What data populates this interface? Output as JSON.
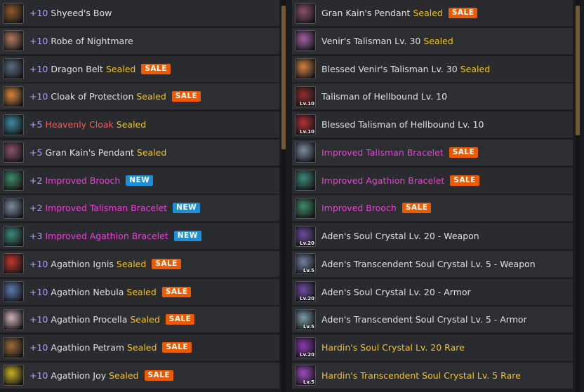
{
  "badges": {
    "sale": "SALE",
    "new": "NEW"
  },
  "left_items": [
    {
      "enchant": "+10",
      "name": "Shyeed's Bow",
      "name_color": "white",
      "sealed": "",
      "badge": "",
      "icon": "bow-icon",
      "icon_color": "#8a5a2b"
    },
    {
      "enchant": "+10",
      "name": "Robe of Nightmare",
      "name_color": "white",
      "sealed": "",
      "badge": "",
      "icon": "robe-icon",
      "icon_color": "#b07a5a"
    },
    {
      "enchant": "+10",
      "name": "Dragon Belt",
      "name_color": "white",
      "sealed": "Sealed",
      "badge": "sale",
      "icon": "belt-icon",
      "icon_color": "#5a6a80"
    },
    {
      "enchant": "+10",
      "name": "Cloak of Protection",
      "name_color": "white",
      "sealed": "Sealed",
      "badge": "sale",
      "icon": "cloak-icon",
      "icon_color": "#d8853a"
    },
    {
      "enchant": "+5",
      "name": "Heavenly Cloak",
      "name_color": "red",
      "sealed": "Sealed",
      "badge": "",
      "icon": "cloak-icon",
      "icon_color": "#3a8aa0"
    },
    {
      "enchant": "+5",
      "name": "Gran Kain's Pendant",
      "name_color": "white",
      "sealed": "Sealed",
      "badge": "",
      "icon": "pendant-icon",
      "icon_color": "#8a5068"
    },
    {
      "enchant": "+2",
      "name": "Improved Brooch",
      "name_color": "pink",
      "sealed": "",
      "badge": "new",
      "icon": "brooch-icon",
      "icon_color": "#3d8a6a"
    },
    {
      "enchant": "+2",
      "name": "Improved Talisman Bracelet",
      "name_color": "pink",
      "sealed": "",
      "badge": "new",
      "icon": "bracelet-icon",
      "icon_color": "#7a8aa0"
    },
    {
      "enchant": "+3",
      "name": "Improved Agathion Bracelet",
      "name_color": "pink",
      "sealed": "",
      "badge": "new",
      "icon": "bracelet-icon",
      "icon_color": "#3a8a7a"
    },
    {
      "enchant": "+10",
      "name": "Agathion Ignis",
      "name_color": "white",
      "sealed": "Sealed",
      "badge": "sale",
      "icon": "agathion-icon",
      "icon_color": "#c0352a"
    },
    {
      "enchant": "+10",
      "name": "Agathion Nebula",
      "name_color": "white",
      "sealed": "Sealed",
      "badge": "sale",
      "icon": "agathion-icon",
      "icon_color": "#5a7ab0"
    },
    {
      "enchant": "+10",
      "name": "Agathion Procella",
      "name_color": "white",
      "sealed": "Sealed",
      "badge": "sale",
      "icon": "agathion-icon",
      "icon_color": "#d0b0b8"
    },
    {
      "enchant": "+10",
      "name": "Agathion Petram",
      "name_color": "white",
      "sealed": "Sealed",
      "badge": "sale",
      "icon": "agathion-icon",
      "icon_color": "#9a6a3a"
    },
    {
      "enchant": "+10",
      "name": "Agathion Joy",
      "name_color": "white",
      "sealed": "Sealed",
      "badge": "sale",
      "icon": "agathion-icon",
      "icon_color": "#c8b020"
    }
  ],
  "right_items": [
    {
      "name": "Gran Kain's Pendant",
      "name_color": "white",
      "sealed": "Sealed",
      "badge": "sale",
      "icon": "pendant-icon",
      "icon_color": "#8a5068",
      "lv": ""
    },
    {
      "name": "Venir's Talisman Lv. 30",
      "name_color": "white",
      "sealed": "Sealed",
      "badge": "",
      "icon": "talisman-icon",
      "icon_color": "#a060a0",
      "lv": ""
    },
    {
      "name": "Blessed Venir's Talisman Lv. 30",
      "name_color": "white",
      "sealed": "Sealed",
      "badge": "",
      "icon": "talisman-icon",
      "icon_color": "#d08040",
      "lv": ""
    },
    {
      "name": "Talisman of Hellbound Lv. 10",
      "name_color": "white",
      "sealed": "",
      "badge": "",
      "icon": "talisman-icon",
      "icon_color": "#902a2a",
      "lv": "Lv.10"
    },
    {
      "name": "Blessed Talisman of Hellbound Lv. 10",
      "name_color": "white",
      "sealed": "",
      "badge": "",
      "icon": "talisman-icon",
      "icon_color": "#b03030",
      "lv": "Lv.10"
    },
    {
      "name": "Improved Talisman Bracelet",
      "name_color": "pink",
      "sealed": "",
      "badge": "sale",
      "icon": "bracelet-icon",
      "icon_color": "#7a8aa0",
      "lv": ""
    },
    {
      "name": "Improved Agathion Bracelet",
      "name_color": "pink",
      "sealed": "",
      "badge": "sale",
      "icon": "bracelet-icon",
      "icon_color": "#3a8a7a",
      "lv": ""
    },
    {
      "name": "Improved Brooch",
      "name_color": "pink",
      "sealed": "",
      "badge": "sale",
      "icon": "brooch-icon",
      "icon_color": "#3d8a6a",
      "lv": ""
    },
    {
      "name": "Aden's Soul Crystal Lv. 20 - Weapon",
      "name_color": "white",
      "sealed": "",
      "badge": "",
      "icon": "crystal-icon",
      "icon_color": "#6a4aa0",
      "lv": "Lv.20"
    },
    {
      "name": "Aden's Transcendent Soul Crystal Lv. 5 - Weapon",
      "name_color": "white",
      "sealed": "",
      "badge": "",
      "icon": "crystal-icon",
      "icon_color": "#7080a0",
      "lv": "Lv.5"
    },
    {
      "name": "Aden's Soul Crystal Lv. 20 - Armor",
      "name_color": "white",
      "sealed": "",
      "badge": "",
      "icon": "crystal-icon",
      "icon_color": "#6a4aa0",
      "lv": "Lv.20"
    },
    {
      "name": "Aden's Transcendent Soul Crystal Lv. 5 - Armor",
      "name_color": "white",
      "sealed": "",
      "badge": "",
      "icon": "crystal-icon",
      "icon_color": "#7a9aa8",
      "lv": "Lv.5"
    },
    {
      "name": "Hardin's Soul Crystal Lv. 20 Rare",
      "name_color": "yellow",
      "sealed": "",
      "badge": "",
      "icon": "crystal-icon",
      "icon_color": "#8a3ab0",
      "lv": "Lv.20"
    },
    {
      "name": "Hardin's Transcendent Soul Crystal Lv. 5 Rare",
      "name_color": "yellow",
      "sealed": "",
      "badge": "",
      "icon": "crystal-icon",
      "icon_color": "#9a4ac0",
      "lv": "Lv.5"
    }
  ]
}
